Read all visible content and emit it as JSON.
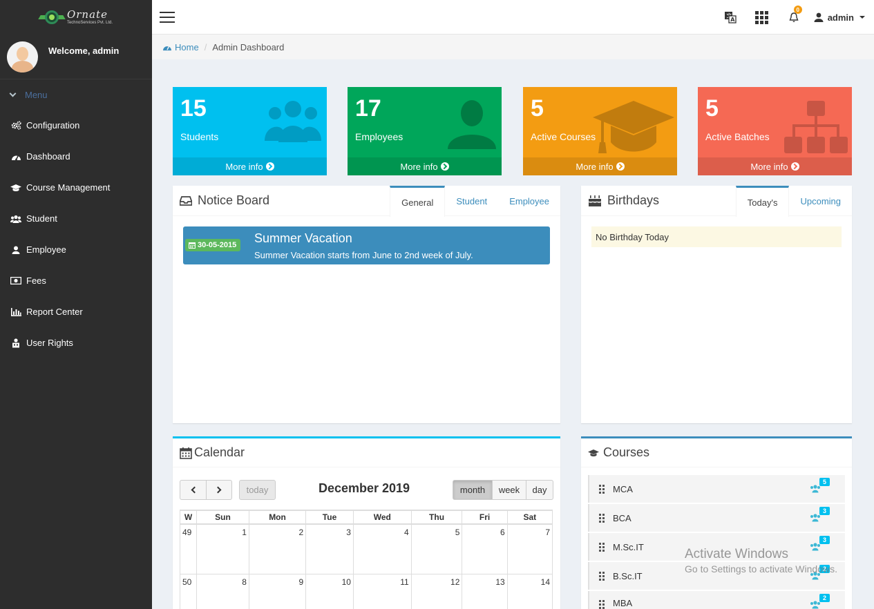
{
  "brand": {
    "name": "Ornate",
    "tagline": "TechnoServices Pvt. Ltd."
  },
  "sidebar": {
    "welcome": "Welcome, admin",
    "menu_header": "Menu",
    "items": [
      {
        "label": "Configuration",
        "icon": "gears-icon"
      },
      {
        "label": "Dashboard",
        "icon": "dashboard-icon"
      },
      {
        "label": "Course Management",
        "icon": "graduation-cap-icon"
      },
      {
        "label": "Student",
        "icon": "users-icon"
      },
      {
        "label": "Employee",
        "icon": "user-icon"
      },
      {
        "label": "Fees",
        "icon": "money-icon"
      },
      {
        "label": "Report Center",
        "icon": "bar-chart-icon"
      },
      {
        "label": "User Rights",
        "icon": "lock-user-icon"
      }
    ]
  },
  "header": {
    "notification_count": "0",
    "user": "admin"
  },
  "breadcrumb": {
    "home": "Home",
    "current": "Admin Dashboard"
  },
  "stats": [
    {
      "value": "15",
      "label": "Students",
      "link": "More info",
      "color": "#00c0ef",
      "icon": "users-icon"
    },
    {
      "value": "17",
      "label": "Employees",
      "link": "More info",
      "color": "#00a65a",
      "icon": "user-icon"
    },
    {
      "value": "5",
      "label": "Active Courses",
      "link": "More info",
      "color": "#f39c12",
      "icon": "graduation-cap-icon"
    },
    {
      "value": "5",
      "label": "Active Batches",
      "link": "More info",
      "color": "#f56954",
      "icon": "sitemap-icon"
    }
  ],
  "notice_board": {
    "title": "Notice Board",
    "tabs": [
      "General",
      "Student",
      "Employee"
    ],
    "active_tab": "General",
    "items": [
      {
        "date": "30-05-2015",
        "title": "Summer Vacation",
        "description": "Summer Vacation starts from June to 2nd week of July."
      }
    ]
  },
  "birthdays": {
    "title": "Birthdays",
    "tabs": [
      "Today's",
      "Upcoming"
    ],
    "active_tab": "Today's",
    "message": "No Birthday Today"
  },
  "calendar": {
    "title": "Calendar",
    "month_label": "December 2019",
    "today_label": "today",
    "views": [
      "month",
      "week",
      "day"
    ],
    "active_view": "month",
    "headers": [
      "W",
      "Sun",
      "Mon",
      "Tue",
      "Wed",
      "Thu",
      "Fri",
      "Sat"
    ],
    "weeks": [
      [
        "49",
        "1",
        "2",
        "3",
        "4",
        "5",
        "6",
        "7"
      ],
      [
        "50",
        "8",
        "9",
        "10",
        "11",
        "12",
        "13",
        "14"
      ]
    ]
  },
  "courses": {
    "title": "Courses",
    "items": [
      {
        "name": "MCA",
        "count": "5"
      },
      {
        "name": "BCA",
        "count": "3"
      },
      {
        "name": "M.Sc.IT",
        "count": "3"
      },
      {
        "name": "B.Sc.IT",
        "count": "2"
      },
      {
        "name": "MBA",
        "count": "2"
      }
    ]
  },
  "watermark": {
    "line1": "Activate Windows",
    "line2": "Go to Settings to activate Windows."
  }
}
